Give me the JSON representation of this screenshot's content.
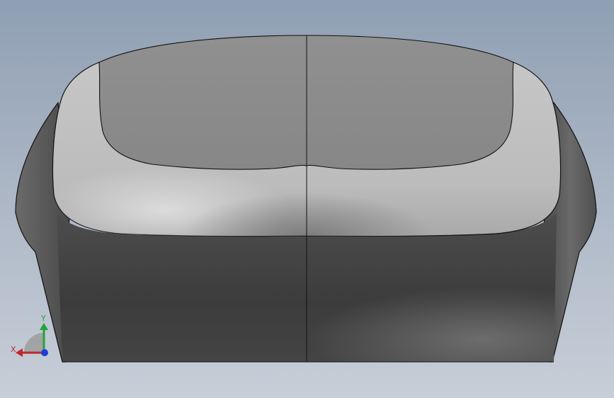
{
  "viewport": {
    "background_top": "#8f9fb3",
    "background_bottom": "#c7ced8"
  },
  "model": {
    "top_face_color": "#8a8a8a",
    "fillet_color": "#bdbdbd",
    "front_face_color": "#474747",
    "side_face_color": "#5e5e5e",
    "edge_color": "#111111"
  },
  "triad": {
    "x_label": "X",
    "y_label": "Y",
    "x_color": "#c0282b",
    "y_color": "#22a33a",
    "z_color": "#1b3fd6"
  }
}
